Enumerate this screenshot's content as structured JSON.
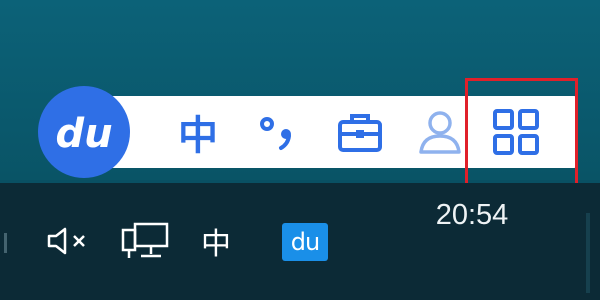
{
  "ime_toolbar": {
    "logo_text": "du",
    "language_mode": "中",
    "punctuation_label": "°,",
    "icons": [
      "du-logo-icon",
      "punctuation-icon",
      "toolbox-icon",
      "user-icon",
      "grid-menu-icon"
    ],
    "accent_color": "#2f6fe6"
  },
  "highlight": {
    "color": "#e0202a",
    "target": "grid-menu-icon"
  },
  "taskbar": {
    "volume_icon": "speaker-muted-icon",
    "network_icon": "network-icon",
    "language_indicator": "中",
    "ime_tray_text": "du",
    "ime_tray_color": "#1a8fe8",
    "clock_time": "20:54"
  }
}
